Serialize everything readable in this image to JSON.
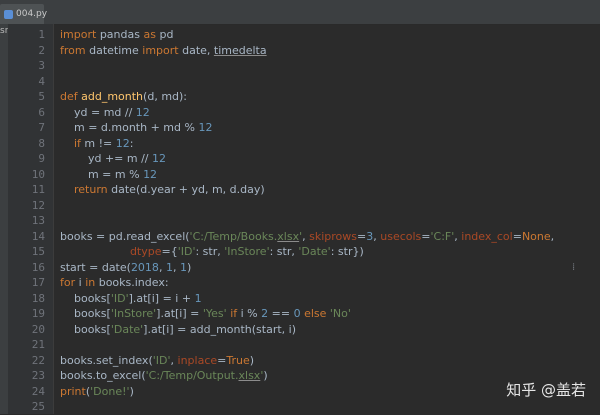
{
  "window": {
    "tab_label": "004.py",
    "left_strip_label": "src"
  },
  "editor": {
    "line_numbers": [
      "1",
      "2",
      "3",
      "4",
      "5",
      "6",
      "7",
      "8",
      "9",
      "10",
      "11",
      "12",
      "13",
      "14",
      "15",
      "16",
      "17",
      "18",
      "19",
      "20",
      "21",
      "22",
      "23",
      "24",
      "25"
    ],
    "lines": [
      [
        {
          "t": "import",
          "c": "kw"
        },
        {
          "t": " pandas ",
          "c": "gray"
        },
        {
          "t": "as",
          "c": "kw"
        },
        {
          "t": " pd",
          "c": "gray"
        }
      ],
      [
        {
          "t": "from",
          "c": "kw"
        },
        {
          "t": " datetime ",
          "c": "gray"
        },
        {
          "t": "import",
          "c": "kw"
        },
        {
          "t": " date, ",
          "c": "gray"
        },
        {
          "t": "timedelta",
          "c": "spell"
        }
      ],
      [],
      [],
      [
        {
          "t": "def ",
          "c": "kw"
        },
        {
          "t": "add_month",
          "c": "fn"
        },
        {
          "t": "(d, md):",
          "c": "gray"
        }
      ],
      [
        {
          "t": "    yd = md // ",
          "c": "gray"
        },
        {
          "t": "12",
          "c": "num-lit"
        }
      ],
      [
        {
          "t": "    m = d.month + md % ",
          "c": "gray"
        },
        {
          "t": "12",
          "c": "num-lit"
        }
      ],
      [
        {
          "t": "    ",
          "c": "gray"
        },
        {
          "t": "if",
          "c": "kw"
        },
        {
          "t": " m != ",
          "c": "gray"
        },
        {
          "t": "12",
          "c": "num-lit"
        },
        {
          "t": ":",
          "c": "gray"
        }
      ],
      [
        {
          "t": "        yd += m // ",
          "c": "gray"
        },
        {
          "t": "12",
          "c": "num-lit"
        }
      ],
      [
        {
          "t": "        m = m % ",
          "c": "gray"
        },
        {
          "t": "12",
          "c": "num-lit"
        }
      ],
      [
        {
          "t": "    ",
          "c": "gray"
        },
        {
          "t": "return",
          "c": "kw"
        },
        {
          "t": " date(d.year + yd, m, d.day)",
          "c": "gray"
        }
      ],
      [],
      [],
      [
        {
          "t": "books = pd.read_excel(",
          "c": "gray"
        },
        {
          "t": "'C:/Temp/Books.",
          "c": "str"
        },
        {
          "t": "xlsx",
          "c": "str spell"
        },
        {
          "t": "'",
          "c": "str"
        },
        {
          "t": ", ",
          "c": "gray"
        },
        {
          "t": "skiprows",
          "c": "param"
        },
        {
          "t": "=",
          "c": "gray"
        },
        {
          "t": "3",
          "c": "num-lit"
        },
        {
          "t": ", ",
          "c": "gray"
        },
        {
          "t": "usecols",
          "c": "param"
        },
        {
          "t": "=",
          "c": "gray"
        },
        {
          "t": "'C:F'",
          "c": "str"
        },
        {
          "t": ", ",
          "c": "gray"
        },
        {
          "t": "index_col",
          "c": "param"
        },
        {
          "t": "=",
          "c": "gray"
        },
        {
          "t": "None",
          "c": "kw"
        },
        {
          "t": ",",
          "c": "gray"
        }
      ],
      [
        {
          "t": "                    ",
          "c": "gray"
        },
        {
          "t": "dtype",
          "c": "param"
        },
        {
          "t": "={",
          "c": "gray"
        },
        {
          "t": "'ID'",
          "c": "str"
        },
        {
          "t": ": str, ",
          "c": "gray"
        },
        {
          "t": "'InStore'",
          "c": "str"
        },
        {
          "t": ": str, ",
          "c": "gray"
        },
        {
          "t": "'Date'",
          "c": "str"
        },
        {
          "t": ": str})",
          "c": "gray"
        }
      ],
      [
        {
          "t": "start = date(",
          "c": "gray"
        },
        {
          "t": "2018",
          "c": "num-lit"
        },
        {
          "t": ", ",
          "c": "gray"
        },
        {
          "t": "1",
          "c": "num-lit"
        },
        {
          "t": ", ",
          "c": "gray"
        },
        {
          "t": "1",
          "c": "num-lit"
        },
        {
          "t": ")",
          "c": "gray"
        }
      ],
      [
        {
          "t": "for",
          "c": "kw"
        },
        {
          "t": " i ",
          "c": "gray"
        },
        {
          "t": "in",
          "c": "kw"
        },
        {
          "t": " books.index:",
          "c": "gray"
        }
      ],
      [
        {
          "t": "    books[",
          "c": "gray"
        },
        {
          "t": "'ID'",
          "c": "str"
        },
        {
          "t": "].at[i] = i + ",
          "c": "gray"
        },
        {
          "t": "1",
          "c": "num-lit"
        }
      ],
      [
        {
          "t": "    books[",
          "c": "gray"
        },
        {
          "t": "'InStore'",
          "c": "str"
        },
        {
          "t": "].at[i] = ",
          "c": "gray"
        },
        {
          "t": "'Yes'",
          "c": "str"
        },
        {
          "t": " ",
          "c": "gray"
        },
        {
          "t": "if",
          "c": "kw"
        },
        {
          "t": " i % ",
          "c": "gray"
        },
        {
          "t": "2",
          "c": "num-lit"
        },
        {
          "t": " == ",
          "c": "gray"
        },
        {
          "t": "0",
          "c": "num-lit"
        },
        {
          "t": " ",
          "c": "gray"
        },
        {
          "t": "else",
          "c": "kw"
        },
        {
          "t": " ",
          "c": "gray"
        },
        {
          "t": "'No'",
          "c": "str"
        }
      ],
      [
        {
          "t": "    books[",
          "c": "gray"
        },
        {
          "t": "'Date'",
          "c": "str"
        },
        {
          "t": "].at[i] = add_month(start, i)",
          "c": "gray"
        }
      ],
      [],
      [
        {
          "t": "books.set_index(",
          "c": "gray"
        },
        {
          "t": "'ID'",
          "c": "str"
        },
        {
          "t": ", ",
          "c": "gray"
        },
        {
          "t": "inplace",
          "c": "param"
        },
        {
          "t": "=",
          "c": "gray"
        },
        {
          "t": "True",
          "c": "kw"
        },
        {
          "t": ")",
          "c": "gray"
        }
      ],
      [
        {
          "t": "books.to_excel(",
          "c": "gray"
        },
        {
          "t": "'C:/Temp/Output.",
          "c": "str"
        },
        {
          "t": "xlsx",
          "c": "str spell"
        },
        {
          "t": "'",
          "c": "str"
        },
        {
          "t": ")",
          "c": "gray"
        }
      ],
      [
        {
          "t": "print",
          "c": "kw"
        },
        {
          "t": "(",
          "c": "gray"
        },
        {
          "t": "'Done!'",
          "c": "str"
        },
        {
          "t": ")",
          "c": "gray"
        }
      ],
      []
    ]
  },
  "watermark": "知乎 @盖若",
  "colors": {
    "background": "#2b2b2b",
    "keyword": "#cc7832",
    "function": "#ffc66d",
    "string": "#6a8759",
    "number": "#6897bb",
    "param": "#aa4926",
    "text": "#a9b7c6"
  }
}
